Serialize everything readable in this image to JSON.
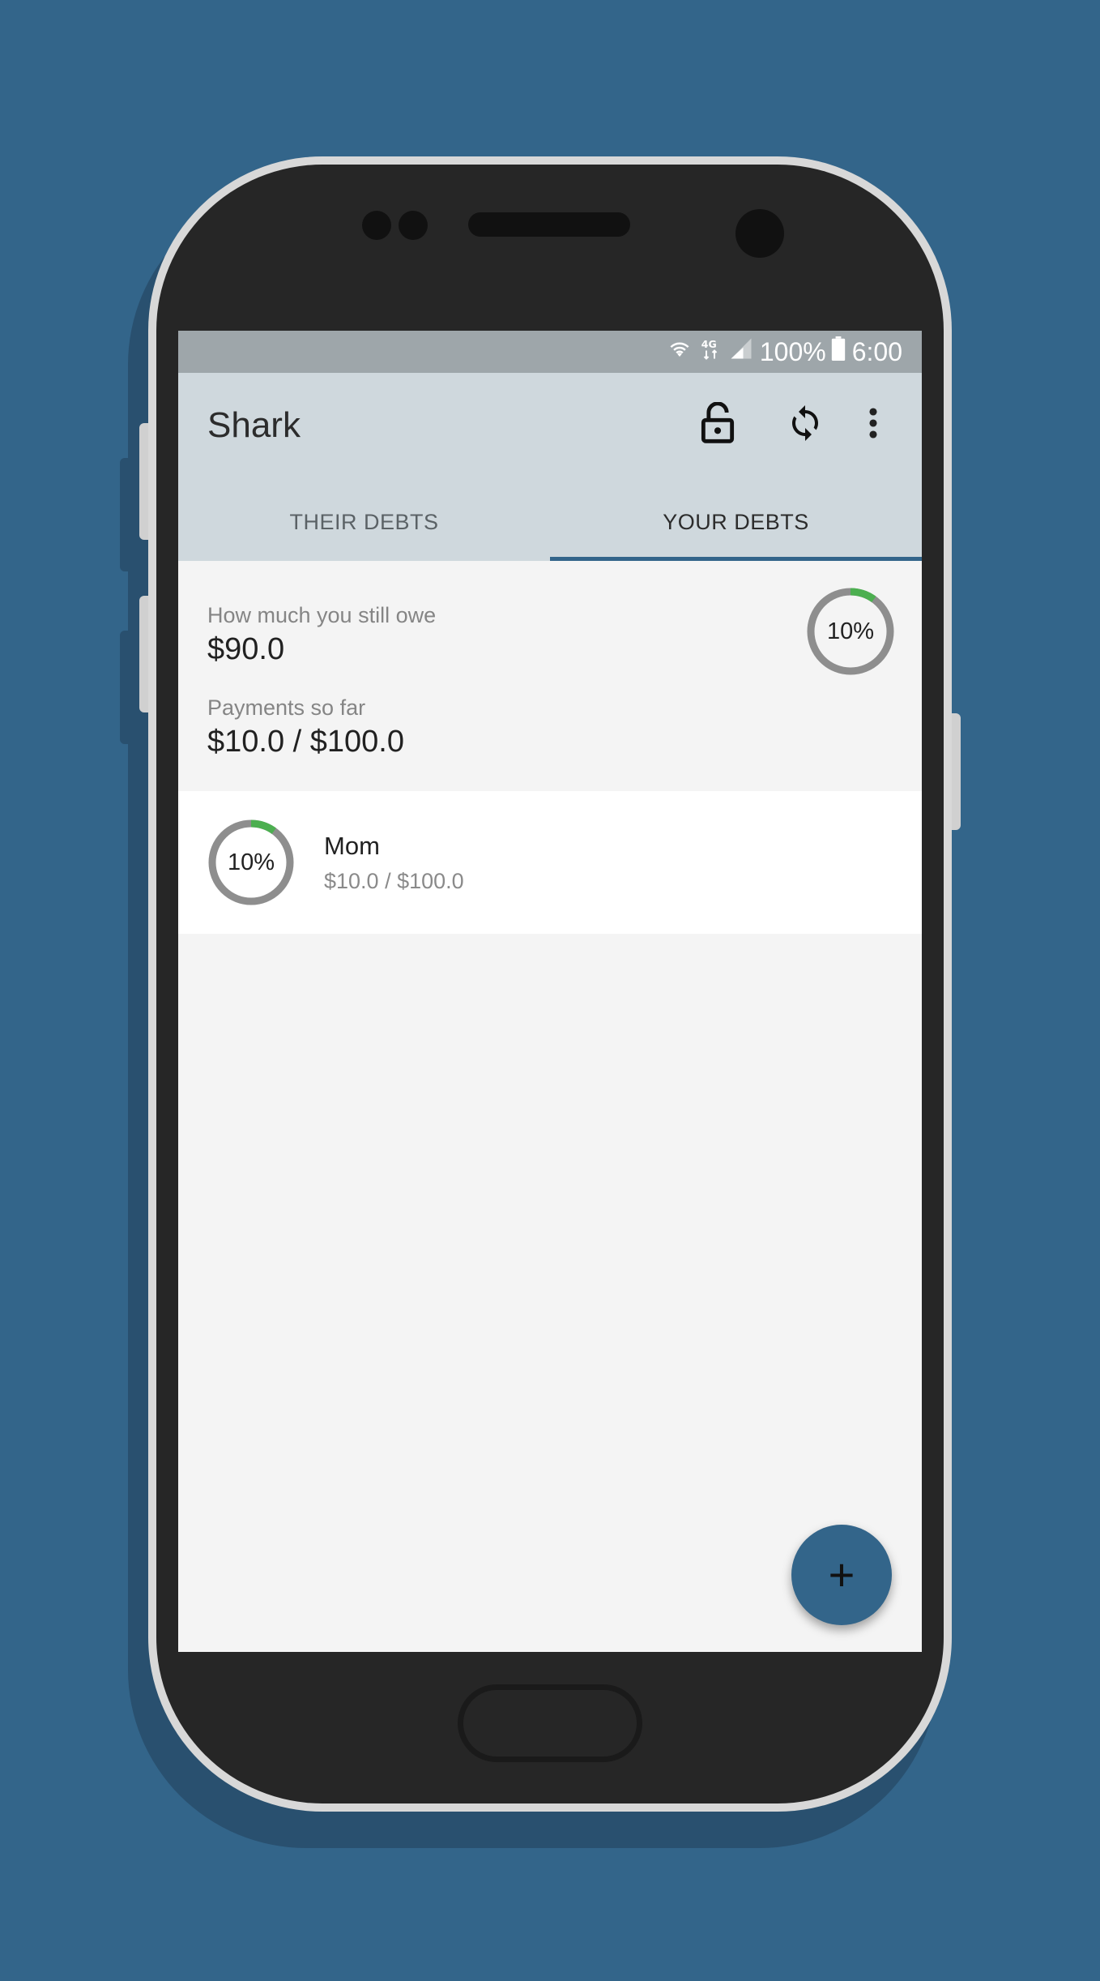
{
  "status_bar": {
    "battery_text": "100%",
    "time": "6:00",
    "icons": [
      "wifi-icon",
      "4g-icon",
      "signal-icon",
      "battery-icon"
    ]
  },
  "app_bar": {
    "title": "Shark",
    "actions": [
      "lock-open-icon",
      "sync-icon",
      "more-vert-icon"
    ]
  },
  "tabs": [
    {
      "label": "THEIR DEBTS",
      "active": false
    },
    {
      "label": "YOUR DEBTS",
      "active": true
    }
  ],
  "summary": {
    "owe_label": "How much you still owe",
    "owe_value": "$90.0",
    "payments_label": "Payments so far",
    "payments_value": "$10.0 / $100.0",
    "progress_percent": 10,
    "progress_label": "10%"
  },
  "debts": [
    {
      "name": "Mom",
      "amount": "$10.0 / $100.0",
      "progress_percent": 10,
      "progress_label": "10%"
    }
  ],
  "fab": {
    "label": "+"
  },
  "colors": {
    "background": "#33658a",
    "app_bar": "#cfd8dd",
    "status_bar": "#9ea6aa",
    "accent": "#33658a",
    "progress": "#4caf50",
    "ring_track": "#8e8e8e"
  }
}
